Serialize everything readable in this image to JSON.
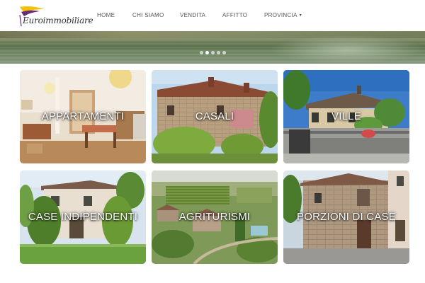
{
  "header": {
    "logo_text": "Euroimmobiliare",
    "nav": [
      {
        "label": "HOME",
        "has_dropdown": false
      },
      {
        "label": "CHI SIAMO",
        "has_dropdown": false
      },
      {
        "label": "VENDITA",
        "has_dropdown": false
      },
      {
        "label": "AFFITTO",
        "has_dropdown": false
      },
      {
        "label": "PROVINCIA",
        "has_dropdown": true
      }
    ]
  },
  "slider": {
    "dot_count": 5,
    "active_index": 1
  },
  "categories": [
    {
      "label": "APPARTAMENTI",
      "image": "apartment-interior"
    },
    {
      "label": "CASALI",
      "image": "stone-farmhouse"
    },
    {
      "label": "VILLE",
      "image": "villa"
    },
    {
      "label": "CASE INDIPENDENTI",
      "image": "detached-house"
    },
    {
      "label": "AGRITURISMI",
      "image": "farm-estate-aerial"
    },
    {
      "label": "PORZIONI DI CASE",
      "image": "house-portion"
    }
  ],
  "colors": {
    "logo_yellow": "#f2c200",
    "logo_purple": "#6a2a7a",
    "nav_text": "#555555",
    "label_text": "#ffffff"
  }
}
